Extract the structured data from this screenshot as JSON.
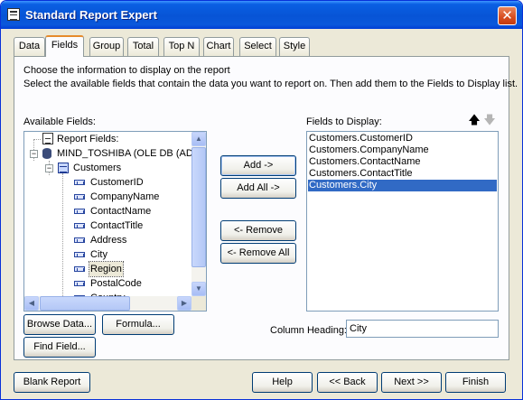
{
  "window": {
    "title": "Standard Report Expert",
    "close": "✕"
  },
  "tabs": [
    "Data",
    "Fields",
    "Group",
    "Total",
    "Top N",
    "Chart",
    "Select",
    "Style"
  ],
  "active_tab": "Fields",
  "instructions": {
    "line1": "Choose the information to display on the report",
    "line2": "Select the available fields that contain the data you want to report on.  Then add them to the Fields to Display list."
  },
  "available_fields": {
    "label": "Available Fields:",
    "report_fields": "Report Fields:",
    "connection": "MIND_TOSHIBA (OLE DB (ADO",
    "table": "Customers",
    "fields": [
      "CustomerID",
      "CompanyName",
      "ContactName",
      "ContactTitle",
      "Address",
      "City",
      "Region",
      "PostalCode",
      "Country"
    ],
    "selected_field": "Region"
  },
  "buttons": {
    "add": "Add ->",
    "add_all": "Add All ->",
    "remove": "<- Remove",
    "remove_all": "<- Remove All",
    "browse_data": "Browse Data...",
    "formula": "Formula...",
    "find_field": "Find Field...",
    "blank_report": "Blank Report",
    "help": "Help",
    "back": "<< Back",
    "next": "Next >>",
    "finish": "Finish"
  },
  "fields_to_display": {
    "label": "Fields to Display:",
    "items": [
      "Customers.CustomerID",
      "Customers.CompanyName",
      "Customers.ContactName",
      "Customers.ContactTitle",
      "Customers.City"
    ],
    "selected_index": 4
  },
  "column_heading": {
    "label": "Column Heading:",
    "value": "City"
  },
  "colors": {
    "selection": "#316ac5",
    "title_bar": "#0754d6",
    "tab_highlight": "#e68b2c"
  }
}
